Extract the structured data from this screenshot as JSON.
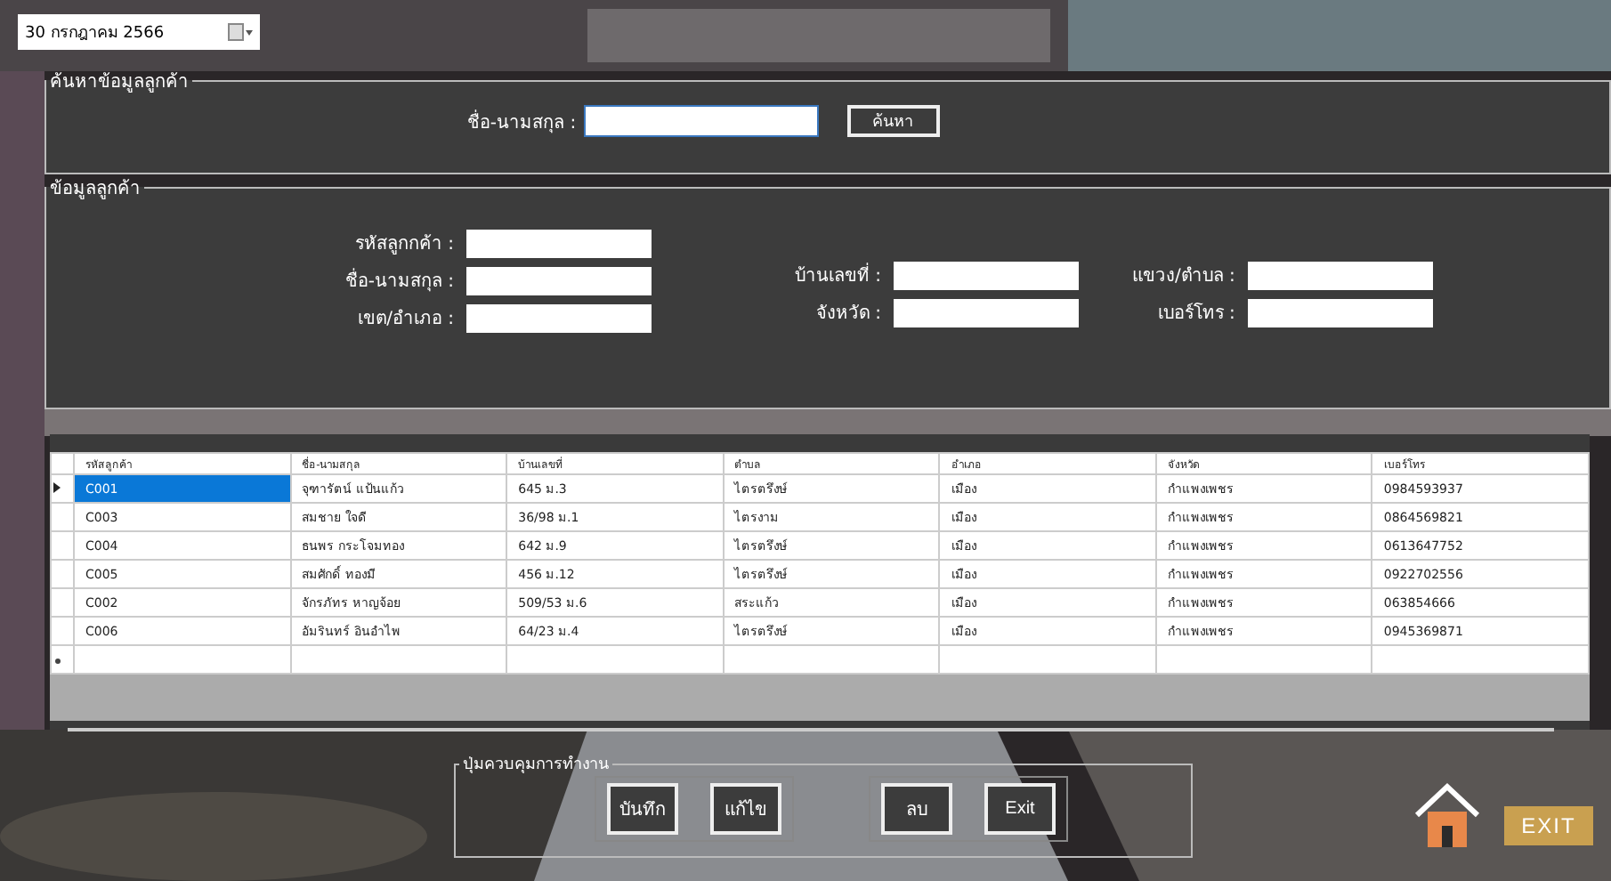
{
  "date_picker": {
    "value": "30  กรกฎาคม   2566"
  },
  "search_group": {
    "title": "ค้นหาข้อมูลลูกค้า",
    "label": "ชื่อ-นามสกุล :",
    "button": "ค้นหา"
  },
  "customer_group": {
    "title": "ข้อมูลลูกค้า",
    "fields": [
      {
        "label": "รหัสลูกกค้า :"
      },
      {
        "label": "ชื่อ-นามสกุล :"
      },
      {
        "label": "เขต/อำเภอ :"
      },
      {
        "label": "บ้านเลขที่ :"
      },
      {
        "label": "จังหวัด :"
      },
      {
        "label": "แขวง/ตำบล :"
      },
      {
        "label": "เบอร์โทร :"
      }
    ]
  },
  "table": {
    "columns": [
      "รหัสลูกค้า",
      "ชื่อ-นามสกุล",
      "บ้านเลขที่",
      "ตำบล",
      "อำเภอ",
      "จังหวัด",
      "เบอร์โทร"
    ],
    "rows": [
      {
        "selected": true,
        "cells": [
          "C001",
          "จุฑารัตน์ แป้นแก้ว",
          "645 ม.3",
          "ไตรตรึงษ์",
          "เมือง",
          "กำแพงเพชร",
          "0984593937"
        ]
      },
      {
        "selected": false,
        "cells": [
          "C003",
          "สมชาย ใจดี",
          "36/98 ม.1",
          "ไตรงาม",
          "เมือง",
          "กำแพงเพชร",
          "0864569821"
        ]
      },
      {
        "selected": false,
        "cells": [
          "C004",
          "ธนพร กระโจมทอง",
          "642 ม.9",
          "ไตรตรึงษ์",
          "เมือง",
          "กำแพงเพชร",
          "0613647752"
        ]
      },
      {
        "selected": false,
        "cells": [
          "C005",
          "สมศักดิ์ ทองมี",
          "456 ม.12",
          "ไตรตรึงษ์",
          "เมือง",
          "กำแพงเพชร",
          "0922702556"
        ]
      },
      {
        "selected": false,
        "cells": [
          "C002",
          "จักรภัทร หาญจ้อย",
          "509/53 ม.6",
          "สระแก้ว",
          "เมือง",
          "กำแพงเพชร",
          "063854666"
        ]
      },
      {
        "selected": false,
        "cells": [
          "C006",
          "อัมรินทร์ อินอำไพ",
          "64/23 ม.4",
          "ไตรตรึงษ์",
          "เมือง",
          "กำแพงเพชร",
          "0945369871"
        ]
      }
    ]
  },
  "control_group": {
    "title": "ปุ่มควบคุมการทำงาน",
    "buttons": [
      "บันทึก",
      "แก้ไข",
      "ลบ",
      "Exit"
    ]
  },
  "exit_button": "EXIT"
}
